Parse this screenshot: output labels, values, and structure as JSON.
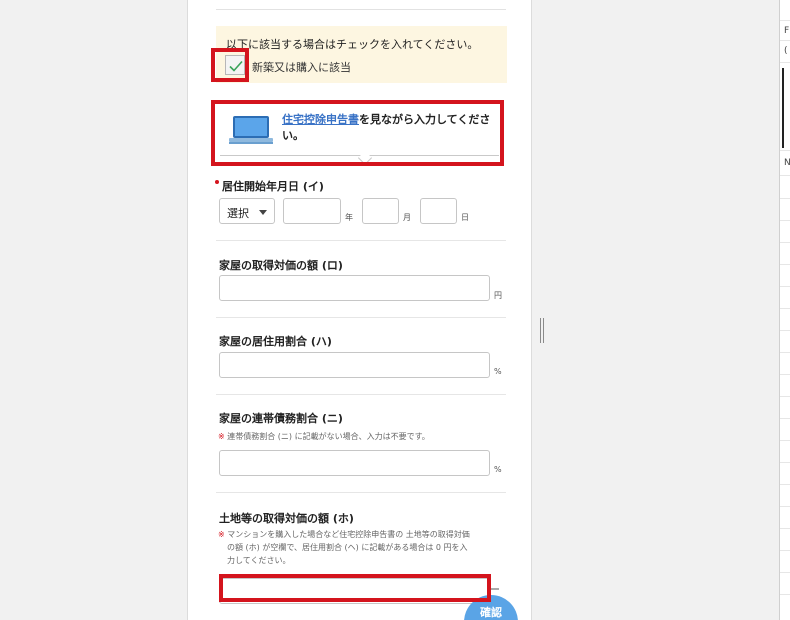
{
  "notice": {
    "text": "以下に該当する場合はチェックを入れてください。",
    "checkbox_label": "新築又は購入に該当",
    "checked": true
  },
  "hint": {
    "link_text": "住宅控除申告書",
    "rest_text": "を見ながら入力してください。"
  },
  "residence_date": {
    "label": "居住開始年月日 (イ)",
    "era_select": "選択",
    "year_unit": "年",
    "month_unit": "月",
    "day_unit": "日"
  },
  "acquisition_price": {
    "label": "家屋の取得対価の額 (ロ)",
    "unit": "円"
  },
  "residence_ratio": {
    "label": "家屋の居住用割合 (ハ)",
    "unit": "%"
  },
  "joint_debt": {
    "label": "家屋の連帯債務割合 (ニ)",
    "note_mark": "※",
    "note": "連帯債務割合 (ニ) に記載がない場合、入力は不要です。",
    "unit": "%"
  },
  "land_price": {
    "label": "土地等の取得対価の額 (ホ)",
    "note_mark": "※",
    "note_lines": [
      "マンションを購入した場合など住宅控除申告書の 土地等の取得対価",
      "の額 (ホ) が空欄で、居住用割合 (ヘ) に記載がある場合は 0 円を入",
      "力してください。"
    ]
  },
  "confirm_button": "確認",
  "right_pane": {
    "letters": [
      "F",
      "(",
      "N"
    ]
  },
  "colors": {
    "accent": "#3a73c6",
    "highlight": "#d4141d",
    "notice_bg": "#fdf6e1",
    "confirm": "#5aa4e6"
  }
}
